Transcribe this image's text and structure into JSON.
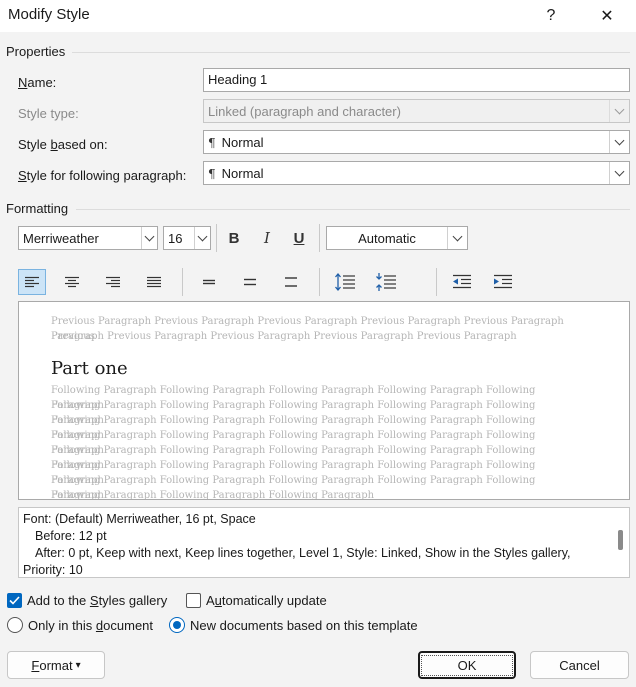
{
  "window": {
    "title": "Modify Style",
    "help_glyph": "?",
    "close_glyph": "✕"
  },
  "properties": {
    "section_label": "Properties",
    "name": {
      "label_u": "N",
      "label_rest": "ame:",
      "value": "Heading 1"
    },
    "style_type": {
      "label": "Style type:",
      "value": "Linked (paragraph and character)"
    },
    "based_on": {
      "label_pre": "Style ",
      "label_u": "b",
      "label_rest": "ased on:",
      "value": "Normal"
    },
    "following": {
      "label_pre": "",
      "label_u": "S",
      "label_rest": "tyle for following paragraph:",
      "value": "Normal"
    },
    "pilcrow": "¶"
  },
  "formatting": {
    "section_label": "Formatting",
    "font": "Merriweather",
    "size": "16",
    "bold": "B",
    "italic": "I",
    "underline": "U",
    "color": "Automatic"
  },
  "preview": {
    "previous_line1": "Previous Paragraph Previous Paragraph Previous Paragraph Previous Paragraph Previous Paragraph Previous",
    "previous_line2": "Paragraph Previous Paragraph Previous Paragraph Previous Paragraph Previous Paragraph",
    "heading": "Part one",
    "following_lines": [
      "Following Paragraph Following Paragraph Following Paragraph Following Paragraph Following Paragraph",
      "Following Paragraph Following Paragraph Following Paragraph Following Paragraph Following Paragraph",
      "Following Paragraph Following Paragraph Following Paragraph Following Paragraph Following Paragraph",
      "Following Paragraph Following Paragraph Following Paragraph Following Paragraph Following Paragraph",
      "Following Paragraph Following Paragraph Following Paragraph Following Paragraph Following Paragraph",
      "Following Paragraph Following Paragraph Following Paragraph Following Paragraph Following Paragraph",
      "Following Paragraph Following Paragraph Following Paragraph Following Paragraph Following Paragraph",
      "Following Paragraph Following Paragraph Following Paragraph Following Paragraph Following Paragraph",
      "Following Paragraph Following Paragraph Following Paragraph"
    ]
  },
  "description": {
    "line1": "Font: (Default) Merriweather, 16 pt, Space",
    "line2": "Before:  12 pt",
    "line3": "After:  0 pt, Keep with next, Keep lines together, Level 1, Style: Linked, Show in the Styles gallery,",
    "line4": "Priority: 10"
  },
  "options": {
    "add_gallery": {
      "pre": "Add to the ",
      "u": "S",
      "rest": "tyles gallery",
      "checked": true
    },
    "auto_update": {
      "pre": "A",
      "u": "u",
      "rest": "tomatically update",
      "checked": false
    },
    "only_doc": {
      "pre": "Only in this ",
      "u": "d",
      "rest": "ocument",
      "checked": false
    },
    "new_docs": {
      "pre": "New documents based on this template",
      "checked": true
    }
  },
  "buttons": {
    "format_u": "F",
    "format_rest": "ormat",
    "format_caret": "▾",
    "ok": "OK",
    "cancel": "Cancel"
  },
  "colors": {
    "accent": "#0067c0",
    "active_bg": "#cce4f7"
  }
}
